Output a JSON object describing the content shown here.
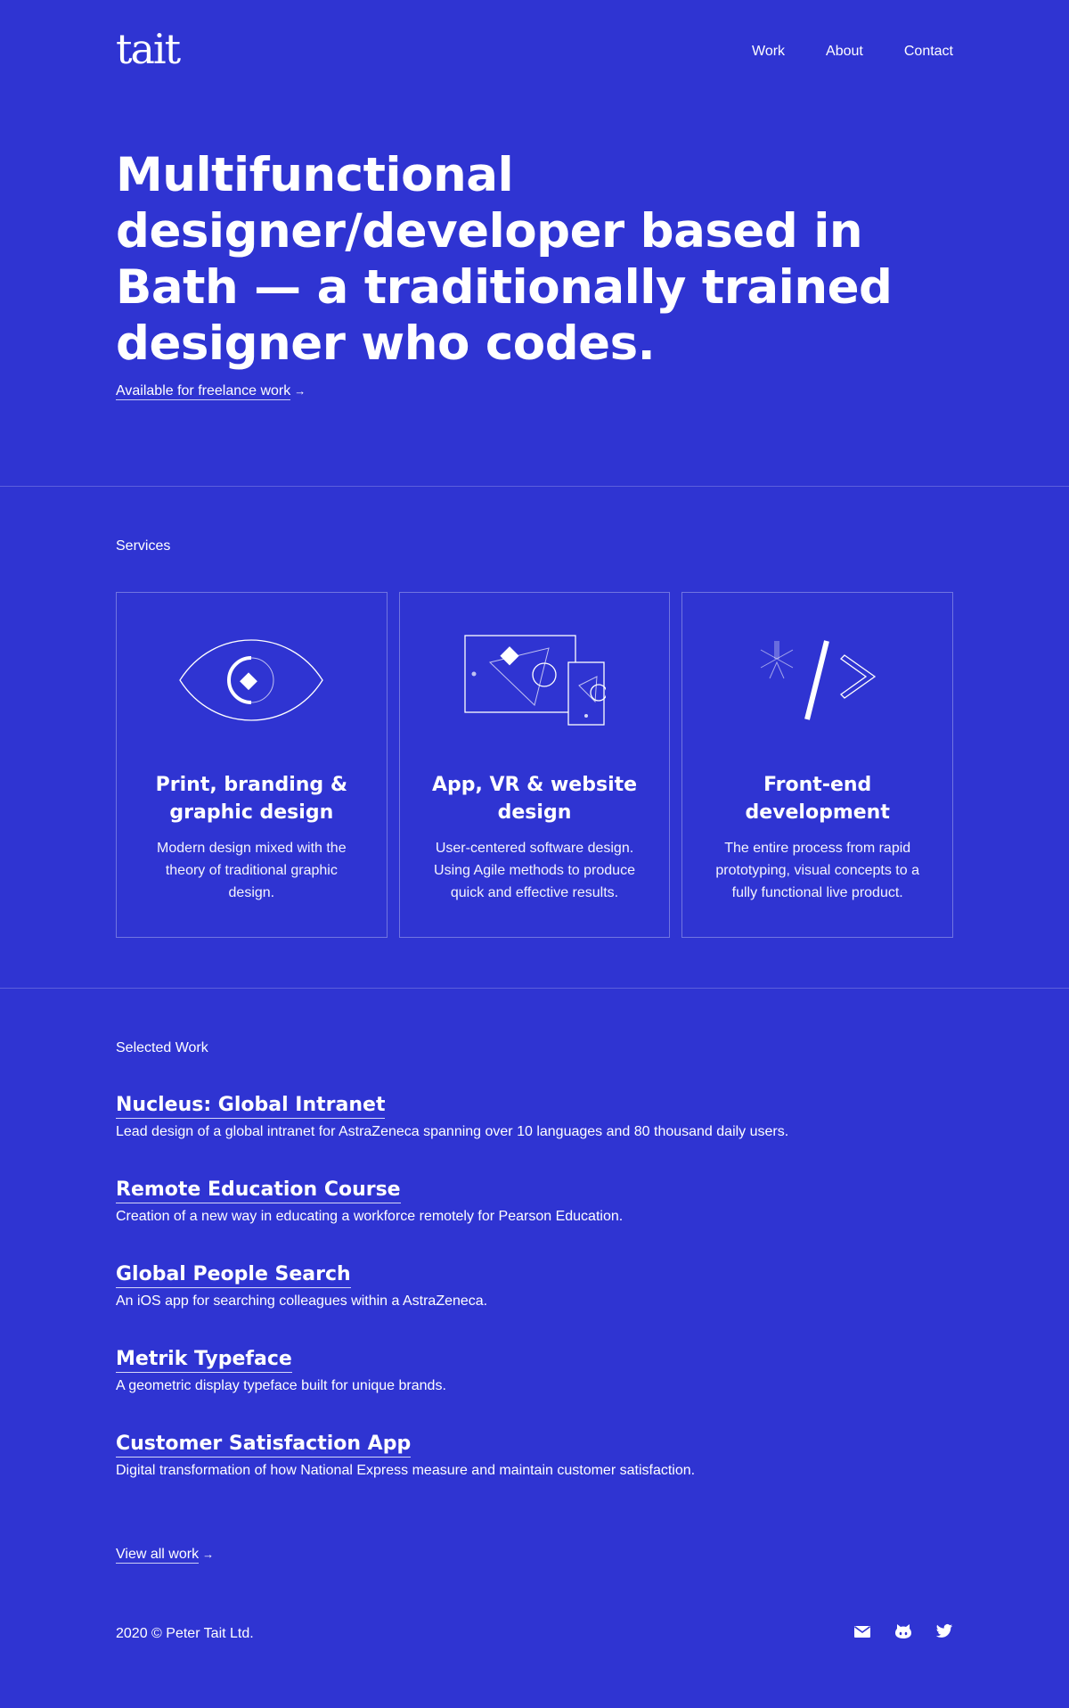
{
  "header": {
    "logo": "tait",
    "nav": [
      "Work",
      "About",
      "Contact"
    ]
  },
  "hero": {
    "title": "Multifunctional designer/developer based in Bath — a traditionally trained designer who codes.",
    "cta": "Available for freelance work",
    "cta_arrow": "→"
  },
  "services": {
    "label": "Services",
    "items": [
      {
        "icon": "eye-icon",
        "title": "Print, branding & graphic design",
        "desc": "Modern design mixed with the theory of traditional graphic design."
      },
      {
        "icon": "devices-icon",
        "title": "App, VR & website design",
        "desc": "User-centered software design. Using Agile methods to produce quick and effective results."
      },
      {
        "icon": "code-icon",
        "title": "Front-end development",
        "desc": "The entire process from rapid prototyping, visual concepts to a fully functional live product."
      }
    ]
  },
  "work": {
    "label": "Selected Work",
    "items": [
      {
        "title": "Nucleus: Global Intranet",
        "desc": "Lead design of a global intranet for AstraZeneca spanning over 10 languages and 80 thousand daily users."
      },
      {
        "title": "Remote Education Course",
        "desc": "Creation of a new way in educating a workforce remotely for Pearson Education."
      },
      {
        "title": "Global People Search",
        "desc": "An iOS app for searching colleagues within a AstraZeneca."
      },
      {
        "title": "Metrik Typeface",
        "desc": "A geometric display typeface built for unique brands."
      },
      {
        "title": "Customer Satisfaction App",
        "desc": "Digital transformation of how National Express measure and maintain customer satisfaction."
      }
    ],
    "view_all": "View all work",
    "view_all_arrow": "→"
  },
  "footer": {
    "copyright": "2020 © Peter Tait Ltd.",
    "social_icons": [
      "mail-icon",
      "github-icon",
      "twitter-icon"
    ]
  },
  "colors": {
    "background": "#2f34d2",
    "text": "#ffffff"
  }
}
